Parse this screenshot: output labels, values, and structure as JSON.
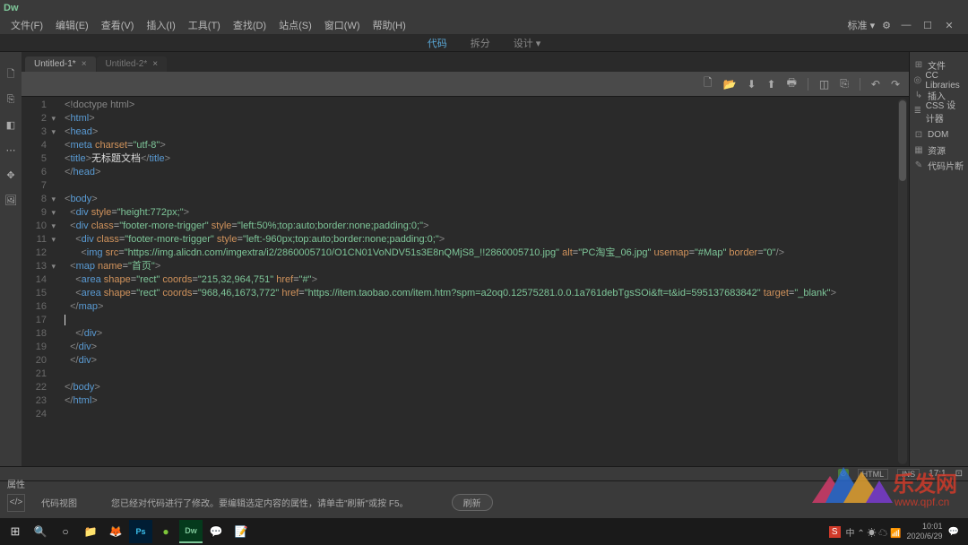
{
  "app": {
    "name": "Dw"
  },
  "menu": [
    "文件(F)",
    "编辑(E)",
    "查看(V)",
    "插入(I)",
    "工具(T)",
    "查找(D)",
    "站点(S)",
    "窗口(W)",
    "帮助(H)"
  ],
  "menu_right": {
    "mode": "标准 ▾",
    "gear": "⚙"
  },
  "window_controls": {
    "min": "—",
    "max": "☐",
    "close": "✕"
  },
  "view_tabs": [
    {
      "label": "代码",
      "active": true
    },
    {
      "label": "拆分",
      "active": false
    },
    {
      "label": "设计 ▾",
      "active": false
    }
  ],
  "doc_tabs": [
    {
      "name": "Untitled-1*",
      "active": true
    },
    {
      "name": "Untitled-2*",
      "active": false
    }
  ],
  "editor_toolbar": [
    "new-file",
    "open",
    "download",
    "upload",
    "print",
    "|",
    "split-panel",
    "diff",
    "|",
    "undo",
    "redo"
  ],
  "editor_toolbar_glyphs": {
    "new-file": "🗋",
    "open": "📂",
    "download": "⬇",
    "upload": "⬆",
    "print": "🖶",
    "split-panel": "◫",
    "diff": "⎘",
    "undo": "↶",
    "redo": "↷"
  },
  "right_panel": [
    {
      "icon": "⊞",
      "label": "文件"
    },
    {
      "icon": "◎",
      "label": "CC Libraries"
    },
    {
      "icon": "↳",
      "label": "插入"
    },
    {
      "icon": "≣",
      "label": "CSS 设计器"
    },
    {
      "icon": "",
      "label": ""
    },
    {
      "icon": "⊡",
      "label": "DOM"
    },
    {
      "icon": "▦",
      "label": "资源"
    },
    {
      "icon": "✎",
      "label": "代码片断"
    }
  ],
  "status": {
    "err": "⊘",
    "lang": "HTML",
    "ins": "INS",
    "pos": "17:1",
    "menu": "⊡"
  },
  "props": {
    "title": "属性",
    "section": "代码视图",
    "msg": "您已经对代码进行了修改。要编辑选定内容的属性，请单击\"刷新\"或按 F5。",
    "btn": "刷新"
  },
  "code": {
    "lines": [
      {
        "n": 1,
        "fold": "",
        "indent": 0,
        "type": "doctype",
        "content": "<!doctype html>"
      },
      {
        "n": 2,
        "fold": "▾",
        "indent": 0,
        "type": "open",
        "tag": "html"
      },
      {
        "n": 3,
        "fold": "▾",
        "indent": 0,
        "type": "open",
        "tag": "head"
      },
      {
        "n": 4,
        "fold": "",
        "indent": 0,
        "type": "selfclose",
        "tag": "meta",
        "attrs": [
          [
            "charset",
            "utf-8"
          ]
        ]
      },
      {
        "n": 5,
        "fold": "",
        "indent": 0,
        "type": "wrap",
        "tag": "title",
        "text": "无标题文档"
      },
      {
        "n": 6,
        "fold": "",
        "indent": 0,
        "type": "close",
        "tag": "head"
      },
      {
        "n": 7,
        "fold": "",
        "indent": 0,
        "type": "blank"
      },
      {
        "n": 8,
        "fold": "▾",
        "indent": 0,
        "type": "open",
        "tag": "body"
      },
      {
        "n": 9,
        "fold": "▾",
        "indent": 1,
        "type": "open",
        "tag": "div",
        "attrs": [
          [
            "style",
            "height:772px;"
          ]
        ]
      },
      {
        "n": 10,
        "fold": "▾",
        "indent": 1,
        "type": "open",
        "tag": "div",
        "attrs": [
          [
            "class",
            "footer-more-trigger"
          ],
          [
            "style",
            "left:50%;top:auto;border:none;padding:0;"
          ]
        ]
      },
      {
        "n": 11,
        "fold": "▾",
        "indent": 2,
        "type": "open",
        "tag": "div",
        "attrs": [
          [
            "class",
            "footer-more-trigger"
          ],
          [
            "style",
            "left:-960px;top:auto;border:none;padding:0;"
          ]
        ]
      },
      {
        "n": 12,
        "fold": "",
        "indent": 3,
        "type": "selfclose_slash",
        "tag": "img",
        "attrs": [
          [
            "src",
            "https://img.alicdn.com/imgextra/i2/2860005710/O1CN01VoNDV51s3E8nQMjS8_!!2860005710.jpg"
          ],
          [
            "alt",
            "PC淘宝_06.jpg"
          ],
          [
            "usemap",
            "#Map"
          ],
          [
            "border",
            "0"
          ]
        ]
      },
      {
        "n": 13,
        "fold": "▾",
        "indent": 1,
        "type": "open",
        "tag": "map",
        "attrs": [
          [
            "name",
            "首页"
          ]
        ]
      },
      {
        "n": 14,
        "fold": "",
        "indent": 2,
        "type": "selfclose",
        "tag": "area",
        "attrs": [
          [
            "shape",
            "rect"
          ],
          [
            "coords",
            "215,32,964,751"
          ],
          [
            "href",
            "#"
          ]
        ]
      },
      {
        "n": 15,
        "fold": "",
        "indent": 2,
        "type": "selfclose",
        "tag": "area",
        "attrs": [
          [
            "shape",
            "rect"
          ],
          [
            "coords",
            "968,46,1673,772"
          ],
          [
            "href",
            "https://item.taobao.com/item.htm?spm=a2oq0.12575281.0.0.1a761debTgsSOi&ft=t&id=595137683842"
          ],
          [
            "target",
            "_blank"
          ]
        ]
      },
      {
        "n": 16,
        "fold": "",
        "indent": 1,
        "type": "close",
        "tag": "map"
      },
      {
        "n": 17,
        "fold": "",
        "indent": 0,
        "type": "cursor"
      },
      {
        "n": 18,
        "fold": "",
        "indent": 2,
        "type": "close",
        "tag": "div"
      },
      {
        "n": 19,
        "fold": "",
        "indent": 1,
        "type": "close",
        "tag": "div"
      },
      {
        "n": 20,
        "fold": "",
        "indent": 1,
        "type": "close",
        "tag": "div"
      },
      {
        "n": 21,
        "fold": "",
        "indent": 0,
        "type": "blank"
      },
      {
        "n": 22,
        "fold": "",
        "indent": 0,
        "type": "close",
        "tag": "body"
      },
      {
        "n": 23,
        "fold": "",
        "indent": 0,
        "type": "close",
        "tag": "html"
      },
      {
        "n": 24,
        "fold": "",
        "indent": 0,
        "type": "blank"
      }
    ]
  },
  "taskbar": {
    "time": "10:01",
    "date": "2020/6/29",
    "tray_text": "中 ⌃ ☀ ☁ 📶"
  }
}
